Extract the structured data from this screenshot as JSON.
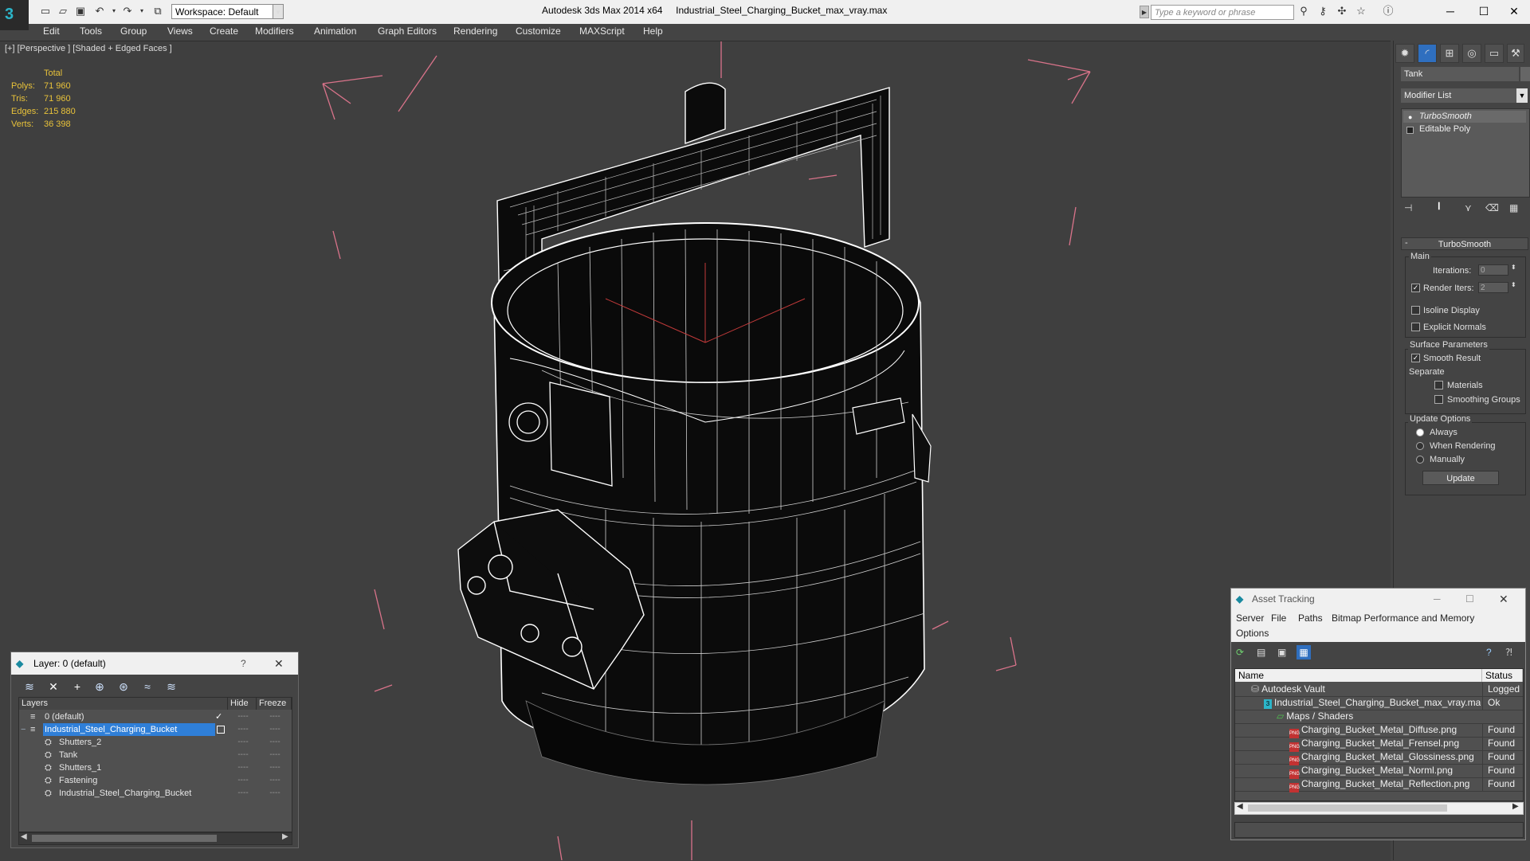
{
  "window": {
    "app_title": "Autodesk 3ds Max  2014 x64",
    "file_title": "Industrial_Steel_Charging_Bucket_max_vray.max",
    "workspace": "Workspace: Default",
    "search_placeholder": "Type a keyword or phrase"
  },
  "menu": [
    "Edit",
    "Tools",
    "Group",
    "Views",
    "Create",
    "Modifiers",
    "Animation",
    "Graph Editors",
    "Rendering",
    "Customize",
    "MAXScript",
    "Help"
  ],
  "viewport": {
    "label": "[+] [Perspective ] [Shaded + Edged Faces ]",
    "stats_header": "Total",
    "stats": [
      {
        "label": "Polys:",
        "value": "71 960"
      },
      {
        "label": "Tris:",
        "value": "71 960"
      },
      {
        "label": "Edges:",
        "value": "215 880"
      },
      {
        "label": "Verts:",
        "value": "36 398"
      }
    ]
  },
  "command_panel": {
    "object_name": "Tank",
    "modifier_list": "Modifier List",
    "stack": [
      "TurboSmooth",
      "Editable Poly"
    ],
    "rollout_title": "TurboSmooth",
    "main_label": "Main",
    "iterations_label": "Iterations:",
    "iterations_value": "0",
    "render_iters_label": "Render Iters:",
    "render_iters_value": "2",
    "render_iters_checked": true,
    "isoline_label": "Isoline Display",
    "explicit_normals_label": "Explicit Normals",
    "surface_params_label": "Surface Parameters",
    "smooth_result_label": "Smooth Result",
    "separate_label": "Separate",
    "materials_label": "Materials",
    "smoothing_groups_label": "Smoothing Groups",
    "update_options_label": "Update Options",
    "always_label": "Always",
    "when_rendering_label": "When Rendering",
    "manually_label": "Manually",
    "update_button": "Update"
  },
  "layer_dialog": {
    "title": "Layer: 0 (default)",
    "help": "?",
    "columns": {
      "layers": "Layers",
      "hide": "Hide",
      "freeze": "Freeze"
    },
    "rows": [
      {
        "name": "0 (default)",
        "indent": 0,
        "selected": false,
        "hide": "----",
        "freeze": "----"
      },
      {
        "name": "Industrial_Steel_Charging_Bucket",
        "indent": 0,
        "selected": true,
        "hide": "----",
        "freeze": "----"
      },
      {
        "name": "Shutters_2",
        "indent": 1,
        "selected": false,
        "hide": "----",
        "freeze": "----"
      },
      {
        "name": "Tank",
        "indent": 1,
        "selected": false,
        "hide": "----",
        "freeze": "----"
      },
      {
        "name": "Shutters_1",
        "indent": 1,
        "selected": false,
        "hide": "----",
        "freeze": "----"
      },
      {
        "name": "Fastening",
        "indent": 1,
        "selected": false,
        "hide": "----",
        "freeze": "----"
      },
      {
        "name": "Industrial_Steel_Charging_Bucket",
        "indent": 1,
        "selected": false,
        "hide": "----",
        "freeze": "----"
      }
    ]
  },
  "asset_tracking": {
    "title": "Asset Tracking",
    "menu": [
      "Server",
      "File",
      "Paths",
      "Bitmap Performance and Memory",
      "Options"
    ],
    "columns": {
      "name": "Name",
      "status": "Status"
    },
    "rows": [
      {
        "name": "Autodesk Vault",
        "status": "Logged O",
        "indent": 0,
        "icon": "vault"
      },
      {
        "name": "Industrial_Steel_Charging_Bucket_max_vray.max",
        "status": "Ok",
        "indent": 1,
        "icon": "max"
      },
      {
        "name": "Maps / Shaders",
        "status": "",
        "indent": 2,
        "icon": "folder"
      },
      {
        "name": "Charging_Bucket_Metal_Diffuse.png",
        "status": "Found",
        "indent": 3,
        "icon": "png"
      },
      {
        "name": "Charging_Bucket_Metal_Frensel.png",
        "status": "Found",
        "indent": 3,
        "icon": "png"
      },
      {
        "name": "Charging_Bucket_Metal_Glossiness.png",
        "status": "Found",
        "indent": 3,
        "icon": "png"
      },
      {
        "name": "Charging_Bucket_Metal_Norml.png",
        "status": "Found",
        "indent": 3,
        "icon": "png"
      },
      {
        "name": "Charging_Bucket_Metal_Reflection.png",
        "status": "Found",
        "indent": 3,
        "icon": "png"
      }
    ]
  },
  "colors": {
    "accent": "#2f7fd8",
    "stats_yellow": "#e8c23a",
    "bbox_pink": "#d9738a",
    "viewport_bg": "#3f3f3f"
  }
}
